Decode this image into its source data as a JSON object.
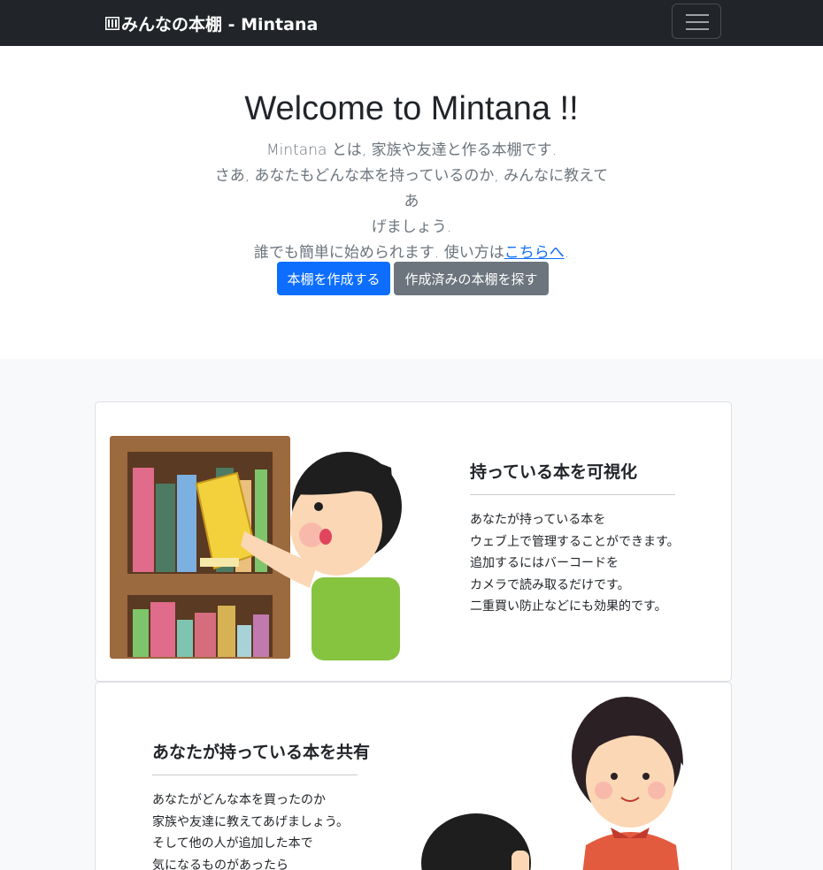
{
  "navbar": {
    "brand": "みんなの本棚 - Mintana",
    "brand_icon": "bookshelf-icon",
    "toggler_icon": "hamburger-menu-icon"
  },
  "hero": {
    "title": "Welcome to Mintana !!",
    "lead_line1": "Mintana とは, 家族や友達と作る本棚です.",
    "lead_line2": "さあ, あなたもどんな本を持っているのか, みんなに教えてあ",
    "lead_line3": "げましょう.",
    "lead_line4_prefix": "誰でも簡単に始められます. 使い方は",
    "lead_link": "こちらへ",
    "lead_line4_suffix": ".",
    "primary_button": "本棚を作成する",
    "secondary_button": "作成済みの本棚を探す"
  },
  "features": [
    {
      "title": "持っている本を可視化",
      "lines": [
        "あなたが持っている本を",
        "ウェブ上で管理することができます。",
        "追加するにはバーコードを",
        "カメラで読み取るだけです。",
        "二重買い防止などにも効果的です。"
      ]
    },
    {
      "title": "あなたが持っている本を共有",
      "lines": [
        "あなたがどんな本を買ったのか",
        "家族や友達に教えてあげましょう。",
        "そして他の人が追加した本で",
        "気になるものがあったら"
      ]
    }
  ],
  "colors": {
    "navbar_bg": "#212529",
    "primary": "#0d6efd",
    "secondary": "#6c757d",
    "page_bg": "#f8f9fa"
  }
}
